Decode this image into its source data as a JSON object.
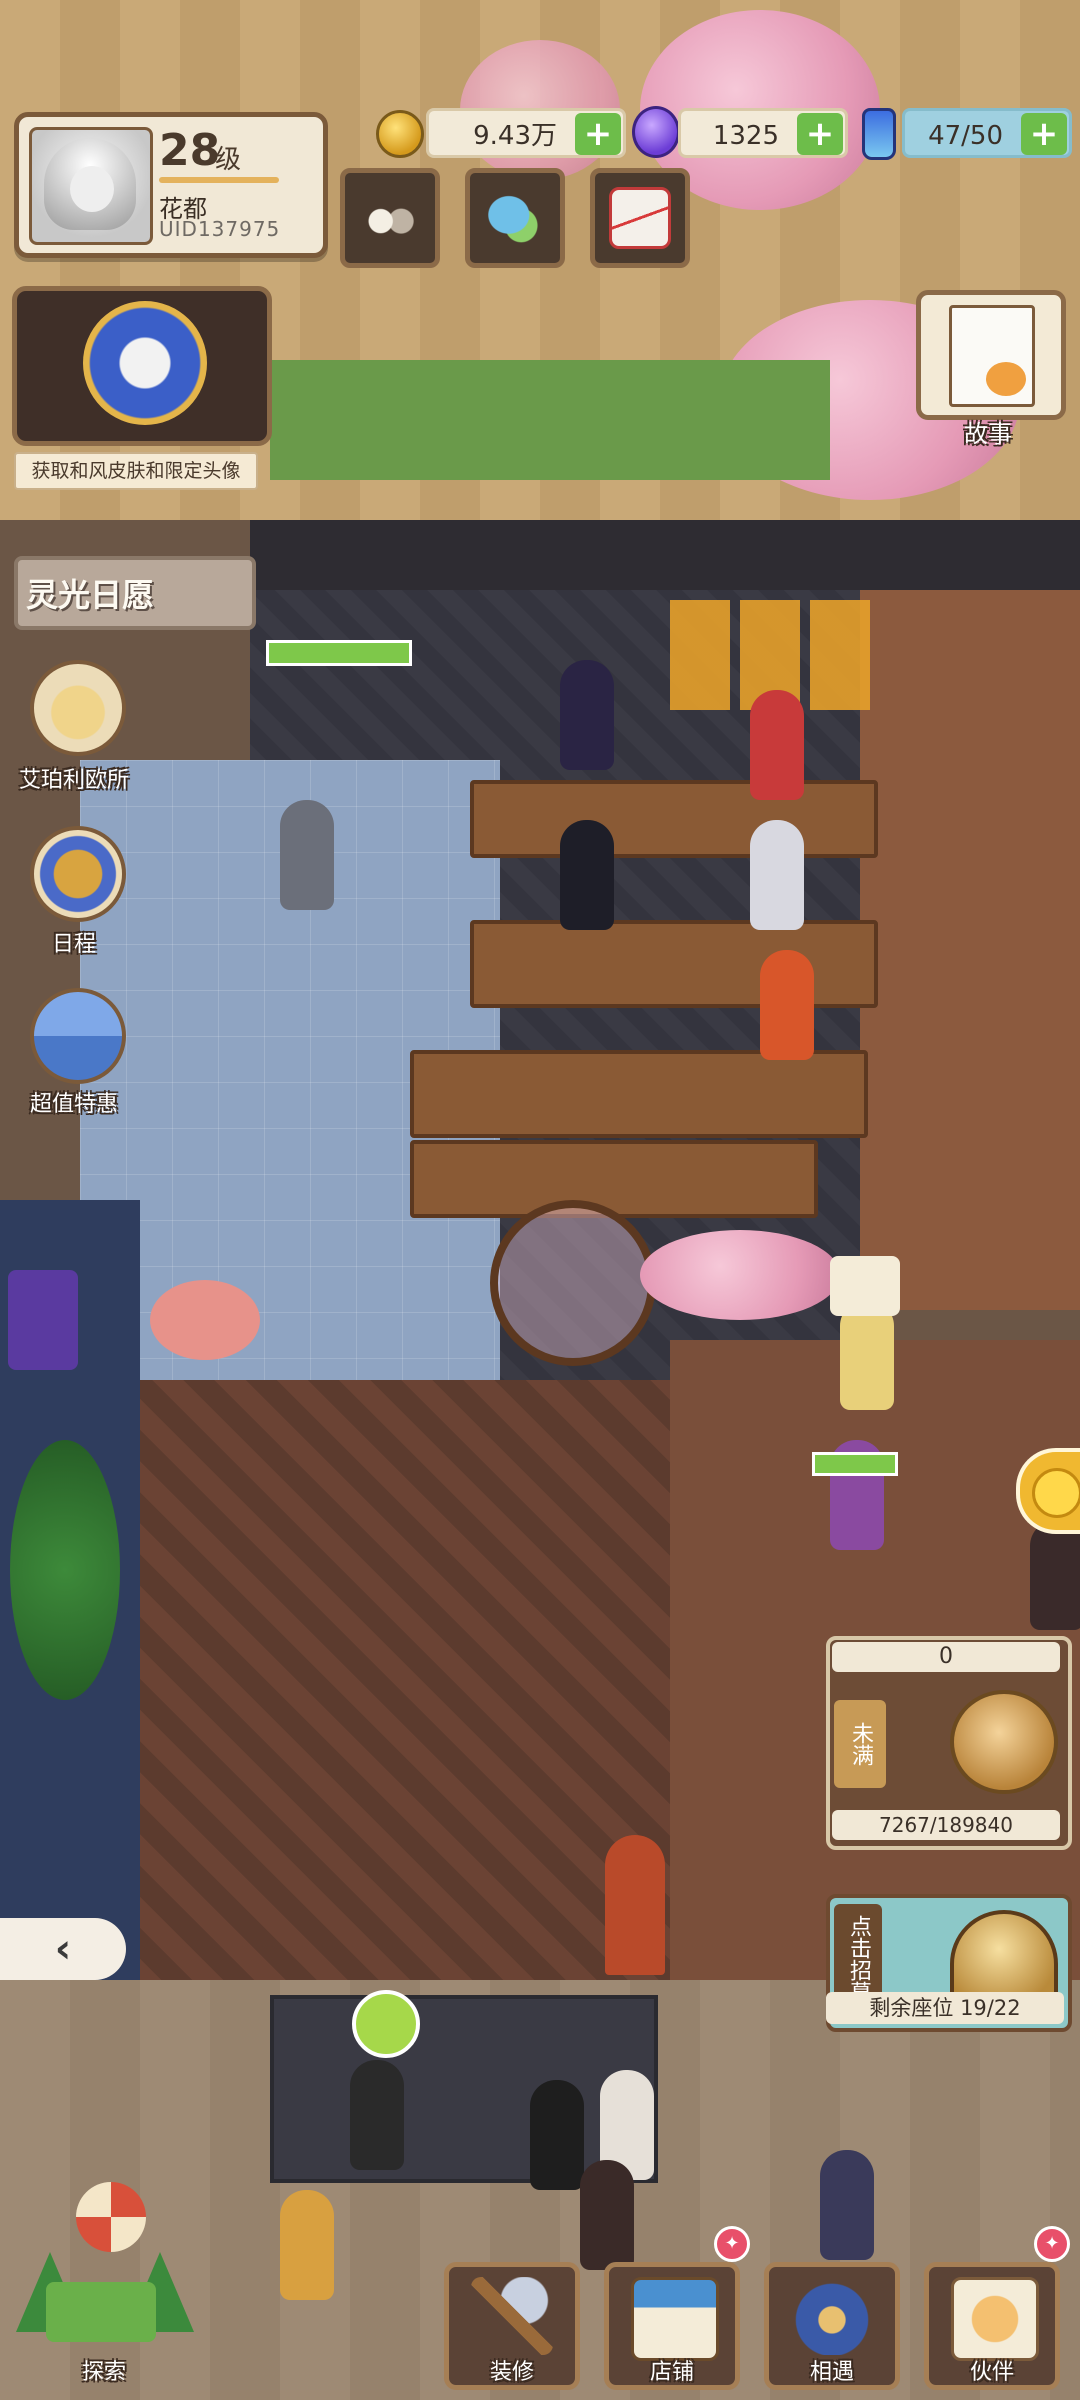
{
  "player": {
    "level": "28",
    "level_suffix": "级",
    "name": "花都",
    "uid": "UID137975"
  },
  "resources": {
    "coins": "9.43万",
    "gems": "1325",
    "energy": "47/50",
    "plus_label": "+"
  },
  "top_buttons": [
    {
      "icon": "cats-icon"
    },
    {
      "icon": "chat-bubbles-icon"
    },
    {
      "icon": "mail-envelope-icon"
    }
  ],
  "banner": {
    "text": "获取和风皮肤和限定头像"
  },
  "wish": {
    "label": "灵光日愿"
  },
  "side_menu": [
    {
      "label": "艾珀利欧所",
      "icon": "owl-detective-icon"
    },
    {
      "label": "日程",
      "icon": "schedule-emblem-icon"
    },
    {
      "label": "超值特惠",
      "icon": "gift-box-icon"
    }
  ],
  "story": {
    "label": "故事",
    "icon": "storybook-icon"
  },
  "counter_panel": {
    "top_value": "0",
    "status_tag": "未满",
    "progress": "7267/189840",
    "progress_fraction": 0.0383
  },
  "recruit": {
    "tag": "点击招募",
    "seats": "剩余座位 19/22"
  },
  "back_tab": {
    "glyph": "‹"
  },
  "bottom_nav": [
    {
      "label": "探索",
      "icon": "explore-windmill-icon"
    },
    {
      "label": "装修",
      "icon": "hammer-icon"
    },
    {
      "label": "店铺",
      "icon": "shop-icon"
    },
    {
      "label": "相遇",
      "icon": "telephone-icon"
    },
    {
      "label": "伙伴",
      "icon": "cat-partner-icon"
    }
  ],
  "colors": {
    "plus_green": "#6dbd4a",
    "panel_brown": "#6d4c36",
    "badge_red": "#e8506a",
    "energy_blue": "#9fd0e0"
  }
}
